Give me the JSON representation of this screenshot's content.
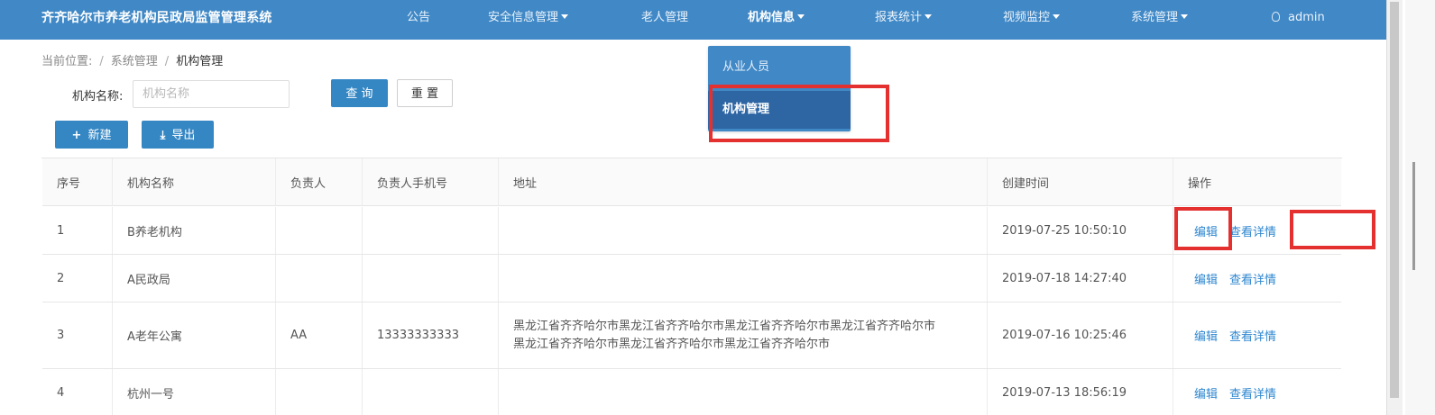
{
  "app": {
    "title": "齐齐哈尔市养老机构民政局监管管理系统"
  },
  "nav": {
    "items": [
      {
        "label": "公告",
        "dropdown": false
      },
      {
        "label": "安全信息管理",
        "dropdown": true
      },
      {
        "label": "老人管理",
        "dropdown": false
      },
      {
        "label": "机构信息",
        "dropdown": true,
        "active": true
      },
      {
        "label": "报表统计",
        "dropdown": true
      },
      {
        "label": "视频监控",
        "dropdown": true
      },
      {
        "label": "系统管理",
        "dropdown": true
      }
    ],
    "user": "admin"
  },
  "dropdown": {
    "items": [
      {
        "label": "从业人员"
      },
      {
        "label": "机构管理",
        "selected": true
      }
    ]
  },
  "breadcrumb": {
    "prefix": "当前位置:",
    "separator": "/",
    "items": [
      "系统管理",
      "机构管理"
    ]
  },
  "search": {
    "label": "机构名称:",
    "placeholder": "机构名称",
    "value": "",
    "query_label": "查 询",
    "reset_label": "重 置"
  },
  "toolbar": {
    "new_label": "新建",
    "export_label": "导出"
  },
  "table": {
    "columns": [
      "序号",
      "机构名称",
      "负责人",
      "负责人手机号",
      "地址",
      "创建时间",
      "操作"
    ],
    "rows": [
      {
        "index": "1",
        "name": "B养老机构",
        "owner": "",
        "phone": "",
        "address_line1": "",
        "address_line2": "",
        "created": "2019-07-25 10:50:10"
      },
      {
        "index": "2",
        "name": "A民政局",
        "owner": "",
        "phone": "",
        "address_line1": "",
        "address_line2": "",
        "created": "2019-07-18 14:27:40"
      },
      {
        "index": "3",
        "name": "A老年公寓",
        "owner": "AA",
        "phone": "13333333333",
        "address_line1": "黑龙江省齐齐哈尔市黑龙江省齐齐哈尔市黑龙江省齐齐哈尔市黑龙江省齐齐哈尔市",
        "address_line2": "黑龙江省齐齐哈尔市黑龙江省齐齐哈尔市黑龙江省齐齐哈尔市",
        "created": "2019-07-16 10:25:46"
      },
      {
        "index": "4",
        "name": "杭州一号",
        "owner": "",
        "phone": "",
        "address_line1": "",
        "address_line2": "",
        "created": "2019-07-13 18:56:19"
      }
    ],
    "actions": {
      "edit": "编辑",
      "view": "查看详情"
    }
  },
  "colors": {
    "nav_bg": "#4088c6",
    "dropdown_selected": "#2e66a4",
    "primary": "#3587c4",
    "link": "#2f87d0",
    "annotation": "#e53030"
  }
}
